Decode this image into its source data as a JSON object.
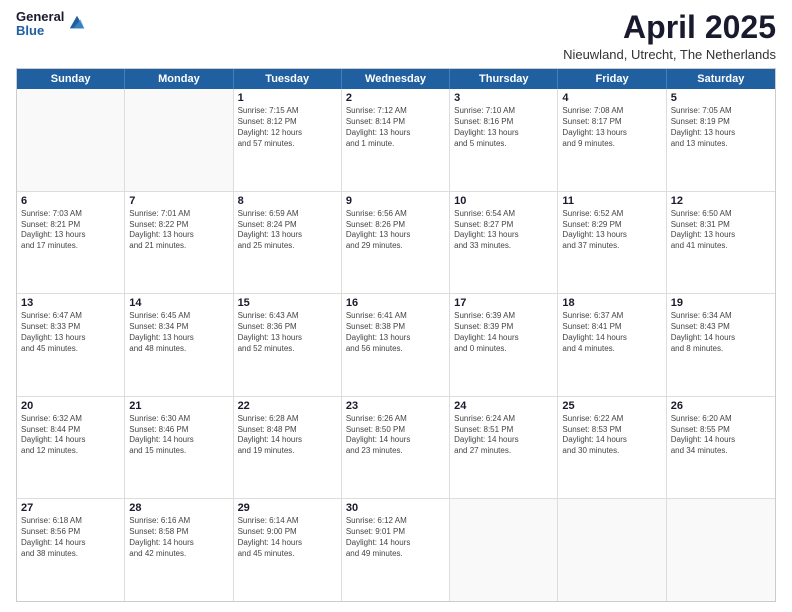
{
  "header": {
    "logo_general": "General",
    "logo_blue": "Blue",
    "month_title": "April 2025",
    "location": "Nieuwland, Utrecht, The Netherlands"
  },
  "weekdays": [
    "Sunday",
    "Monday",
    "Tuesday",
    "Wednesday",
    "Thursday",
    "Friday",
    "Saturday"
  ],
  "rows": [
    [
      {
        "day": "",
        "lines": []
      },
      {
        "day": "",
        "lines": []
      },
      {
        "day": "1",
        "lines": [
          "Sunrise: 7:15 AM",
          "Sunset: 8:12 PM",
          "Daylight: 12 hours",
          "and 57 minutes."
        ]
      },
      {
        "day": "2",
        "lines": [
          "Sunrise: 7:12 AM",
          "Sunset: 8:14 PM",
          "Daylight: 13 hours",
          "and 1 minute."
        ]
      },
      {
        "day": "3",
        "lines": [
          "Sunrise: 7:10 AM",
          "Sunset: 8:16 PM",
          "Daylight: 13 hours",
          "and 5 minutes."
        ]
      },
      {
        "day": "4",
        "lines": [
          "Sunrise: 7:08 AM",
          "Sunset: 8:17 PM",
          "Daylight: 13 hours",
          "and 9 minutes."
        ]
      },
      {
        "day": "5",
        "lines": [
          "Sunrise: 7:05 AM",
          "Sunset: 8:19 PM",
          "Daylight: 13 hours",
          "and 13 minutes."
        ]
      }
    ],
    [
      {
        "day": "6",
        "lines": [
          "Sunrise: 7:03 AM",
          "Sunset: 8:21 PM",
          "Daylight: 13 hours",
          "and 17 minutes."
        ]
      },
      {
        "day": "7",
        "lines": [
          "Sunrise: 7:01 AM",
          "Sunset: 8:22 PM",
          "Daylight: 13 hours",
          "and 21 minutes."
        ]
      },
      {
        "day": "8",
        "lines": [
          "Sunrise: 6:59 AM",
          "Sunset: 8:24 PM",
          "Daylight: 13 hours",
          "and 25 minutes."
        ]
      },
      {
        "day": "9",
        "lines": [
          "Sunrise: 6:56 AM",
          "Sunset: 8:26 PM",
          "Daylight: 13 hours",
          "and 29 minutes."
        ]
      },
      {
        "day": "10",
        "lines": [
          "Sunrise: 6:54 AM",
          "Sunset: 8:27 PM",
          "Daylight: 13 hours",
          "and 33 minutes."
        ]
      },
      {
        "day": "11",
        "lines": [
          "Sunrise: 6:52 AM",
          "Sunset: 8:29 PM",
          "Daylight: 13 hours",
          "and 37 minutes."
        ]
      },
      {
        "day": "12",
        "lines": [
          "Sunrise: 6:50 AM",
          "Sunset: 8:31 PM",
          "Daylight: 13 hours",
          "and 41 minutes."
        ]
      }
    ],
    [
      {
        "day": "13",
        "lines": [
          "Sunrise: 6:47 AM",
          "Sunset: 8:33 PM",
          "Daylight: 13 hours",
          "and 45 minutes."
        ]
      },
      {
        "day": "14",
        "lines": [
          "Sunrise: 6:45 AM",
          "Sunset: 8:34 PM",
          "Daylight: 13 hours",
          "and 48 minutes."
        ]
      },
      {
        "day": "15",
        "lines": [
          "Sunrise: 6:43 AM",
          "Sunset: 8:36 PM",
          "Daylight: 13 hours",
          "and 52 minutes."
        ]
      },
      {
        "day": "16",
        "lines": [
          "Sunrise: 6:41 AM",
          "Sunset: 8:38 PM",
          "Daylight: 13 hours",
          "and 56 minutes."
        ]
      },
      {
        "day": "17",
        "lines": [
          "Sunrise: 6:39 AM",
          "Sunset: 8:39 PM",
          "Daylight: 14 hours",
          "and 0 minutes."
        ]
      },
      {
        "day": "18",
        "lines": [
          "Sunrise: 6:37 AM",
          "Sunset: 8:41 PM",
          "Daylight: 14 hours",
          "and 4 minutes."
        ]
      },
      {
        "day": "19",
        "lines": [
          "Sunrise: 6:34 AM",
          "Sunset: 8:43 PM",
          "Daylight: 14 hours",
          "and 8 minutes."
        ]
      }
    ],
    [
      {
        "day": "20",
        "lines": [
          "Sunrise: 6:32 AM",
          "Sunset: 8:44 PM",
          "Daylight: 14 hours",
          "and 12 minutes."
        ]
      },
      {
        "day": "21",
        "lines": [
          "Sunrise: 6:30 AM",
          "Sunset: 8:46 PM",
          "Daylight: 14 hours",
          "and 15 minutes."
        ]
      },
      {
        "day": "22",
        "lines": [
          "Sunrise: 6:28 AM",
          "Sunset: 8:48 PM",
          "Daylight: 14 hours",
          "and 19 minutes."
        ]
      },
      {
        "day": "23",
        "lines": [
          "Sunrise: 6:26 AM",
          "Sunset: 8:50 PM",
          "Daylight: 14 hours",
          "and 23 minutes."
        ]
      },
      {
        "day": "24",
        "lines": [
          "Sunrise: 6:24 AM",
          "Sunset: 8:51 PM",
          "Daylight: 14 hours",
          "and 27 minutes."
        ]
      },
      {
        "day": "25",
        "lines": [
          "Sunrise: 6:22 AM",
          "Sunset: 8:53 PM",
          "Daylight: 14 hours",
          "and 30 minutes."
        ]
      },
      {
        "day": "26",
        "lines": [
          "Sunrise: 6:20 AM",
          "Sunset: 8:55 PM",
          "Daylight: 14 hours",
          "and 34 minutes."
        ]
      }
    ],
    [
      {
        "day": "27",
        "lines": [
          "Sunrise: 6:18 AM",
          "Sunset: 8:56 PM",
          "Daylight: 14 hours",
          "and 38 minutes."
        ]
      },
      {
        "day": "28",
        "lines": [
          "Sunrise: 6:16 AM",
          "Sunset: 8:58 PM",
          "Daylight: 14 hours",
          "and 42 minutes."
        ]
      },
      {
        "day": "29",
        "lines": [
          "Sunrise: 6:14 AM",
          "Sunset: 9:00 PM",
          "Daylight: 14 hours",
          "and 45 minutes."
        ]
      },
      {
        "day": "30",
        "lines": [
          "Sunrise: 6:12 AM",
          "Sunset: 9:01 PM",
          "Daylight: 14 hours",
          "and 49 minutes."
        ]
      },
      {
        "day": "",
        "lines": []
      },
      {
        "day": "",
        "lines": []
      },
      {
        "day": "",
        "lines": []
      }
    ]
  ]
}
